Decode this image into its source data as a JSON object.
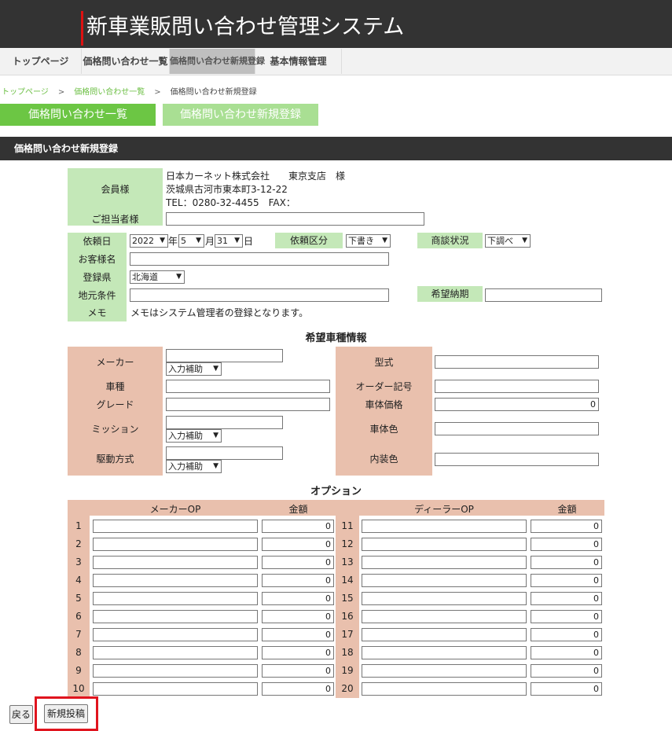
{
  "header": {
    "title": "新車業販問い合わせ管理システム"
  },
  "nav": {
    "tabs": [
      "トップページ",
      "価格問い合わせ一覧",
      "価格問い合わせ新規登録",
      "基本情報管理"
    ]
  },
  "breadcrumb": {
    "items": [
      "トップページ",
      "価格問い合わせ一覧",
      "価格問い合わせ新規登録"
    ],
    "sep": ">"
  },
  "buttons": {
    "list": "価格問い合わせ一覧",
    "new": "価格問い合わせ新規登録",
    "back": "戻る",
    "submit": "新規投稿"
  },
  "section": {
    "title": "価格問い合わせ新規登録"
  },
  "member": {
    "label": "会員様",
    "company": "日本カーネット株式会社　　東京支店　様",
    "address": "茨城県古河市東本町3-12-22",
    "tel": "TEL：0280-32-4455　FAX：",
    "contact_label": "ご担当者様",
    "contact_value": ""
  },
  "request": {
    "date_label": "依頼日",
    "year": "2022",
    "year_unit": "年",
    "month": "5",
    "month_unit": "月",
    "day": "31",
    "day_unit": "日",
    "type_label": "依頼区分",
    "type_value": "下書き",
    "status_label": "商談状況",
    "status_value": "下調べ",
    "customer_label": "お客様名",
    "customer_value": "",
    "pref_label": "登録県",
    "pref_value": "北海道",
    "cond_label": "地元条件",
    "cond_value": "",
    "delivery_label": "希望納期",
    "delivery_value": "",
    "memo_label": "メモ",
    "memo_text": "メモはシステム管理者の登録となります。"
  },
  "vehicle": {
    "title": "希望車種情報",
    "helper": "入力補助",
    "maker_label": "メーカー",
    "car_label": "車種",
    "grade_label": "グレード",
    "mission_label": "ミッション",
    "drive_label": "駆動方式",
    "model_label": "型式",
    "order_label": "オーダー記号",
    "price_label": "車体価格",
    "price_value": "0",
    "color_label": "車体色",
    "interior_label": "内装色"
  },
  "options": {
    "title": "オプション",
    "maker_op": "メーカーOP",
    "amount": "金額",
    "dealer_op": "ディーラーOP",
    "left_nums": [
      "1",
      "2",
      "3",
      "4",
      "5",
      "6",
      "7",
      "8",
      "9",
      "10"
    ],
    "right_nums": [
      "11",
      "12",
      "13",
      "14",
      "15",
      "16",
      "17",
      "18",
      "19",
      "20"
    ],
    "zero": "0"
  },
  "colors": {
    "accent_green": "#6cc644",
    "header_dark": "#333333",
    "label_green": "#c4e8b8",
    "label_pink": "#e9c0ad",
    "highlight_red": "#e0141e"
  }
}
